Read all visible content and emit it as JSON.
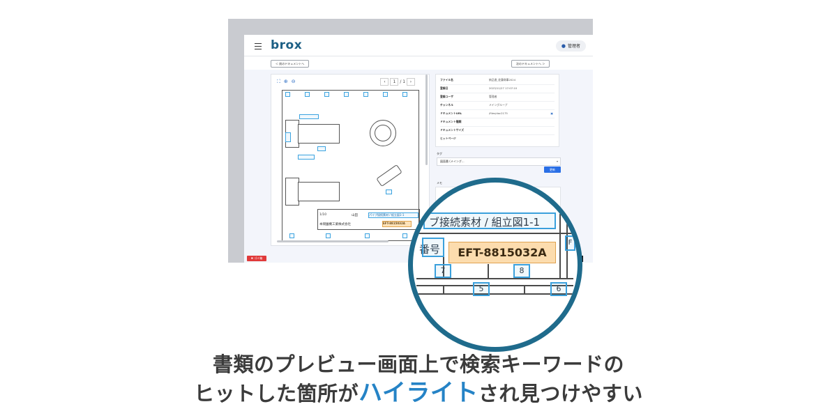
{
  "app": {
    "logo": "brox",
    "user_label": "管理者",
    "prev_doc": "＜ 前のドキュメントへ",
    "next_doc": "次のドキュメントへ ＞"
  },
  "viewer": {
    "page_current": "1",
    "page_total": "1",
    "title_block": {
      "scale": "1/10",
      "drawer": "山田",
      "title_text": "パイプ接続素材 / 組立図1-1",
      "company": "本間園機工業株式会社",
      "number_hit": "EFT-8815032A"
    }
  },
  "info_panel": {
    "rows": [
      {
        "key": "ファイル名",
        "value": "納品書_佐藤商事2024"
      },
      {
        "key": "登録日",
        "value": "2023/11/27 17:07:10"
      },
      {
        "key": "登録ユーザ",
        "value": "管理者"
      },
      {
        "key": "チャンネル",
        "value": "メイングループ"
      },
      {
        "key": "ドキュメントURL",
        "value": "/files/doc2175"
      },
      {
        "key": "ドキュメント種類",
        "value": ""
      },
      {
        "key": "ドキュメントサイズ",
        "value": ""
      },
      {
        "key": "ヒットページ",
        "value": ""
      }
    ]
  },
  "tags": {
    "label": "タグ",
    "selected": "図面番 (メイング...",
    "update_button": "更新"
  },
  "memo": {
    "label": "メモ"
  },
  "badge": "✖ ゴミ箱",
  "magnifier": {
    "title_text": "ブ接続素材 / 組立図1-1",
    "number_label": "番号",
    "number_hit": "EFT-8815032A",
    "grid_labels": [
      "7",
      "8",
      "5",
      "6",
      "F"
    ]
  },
  "caption": {
    "line1": "書類のプレビュー画面上で検索キーワードの",
    "line2_pre": "ヒットした箇所が",
    "line2_accent": "ハイライト",
    "line2_post": "され見つけやすい"
  }
}
